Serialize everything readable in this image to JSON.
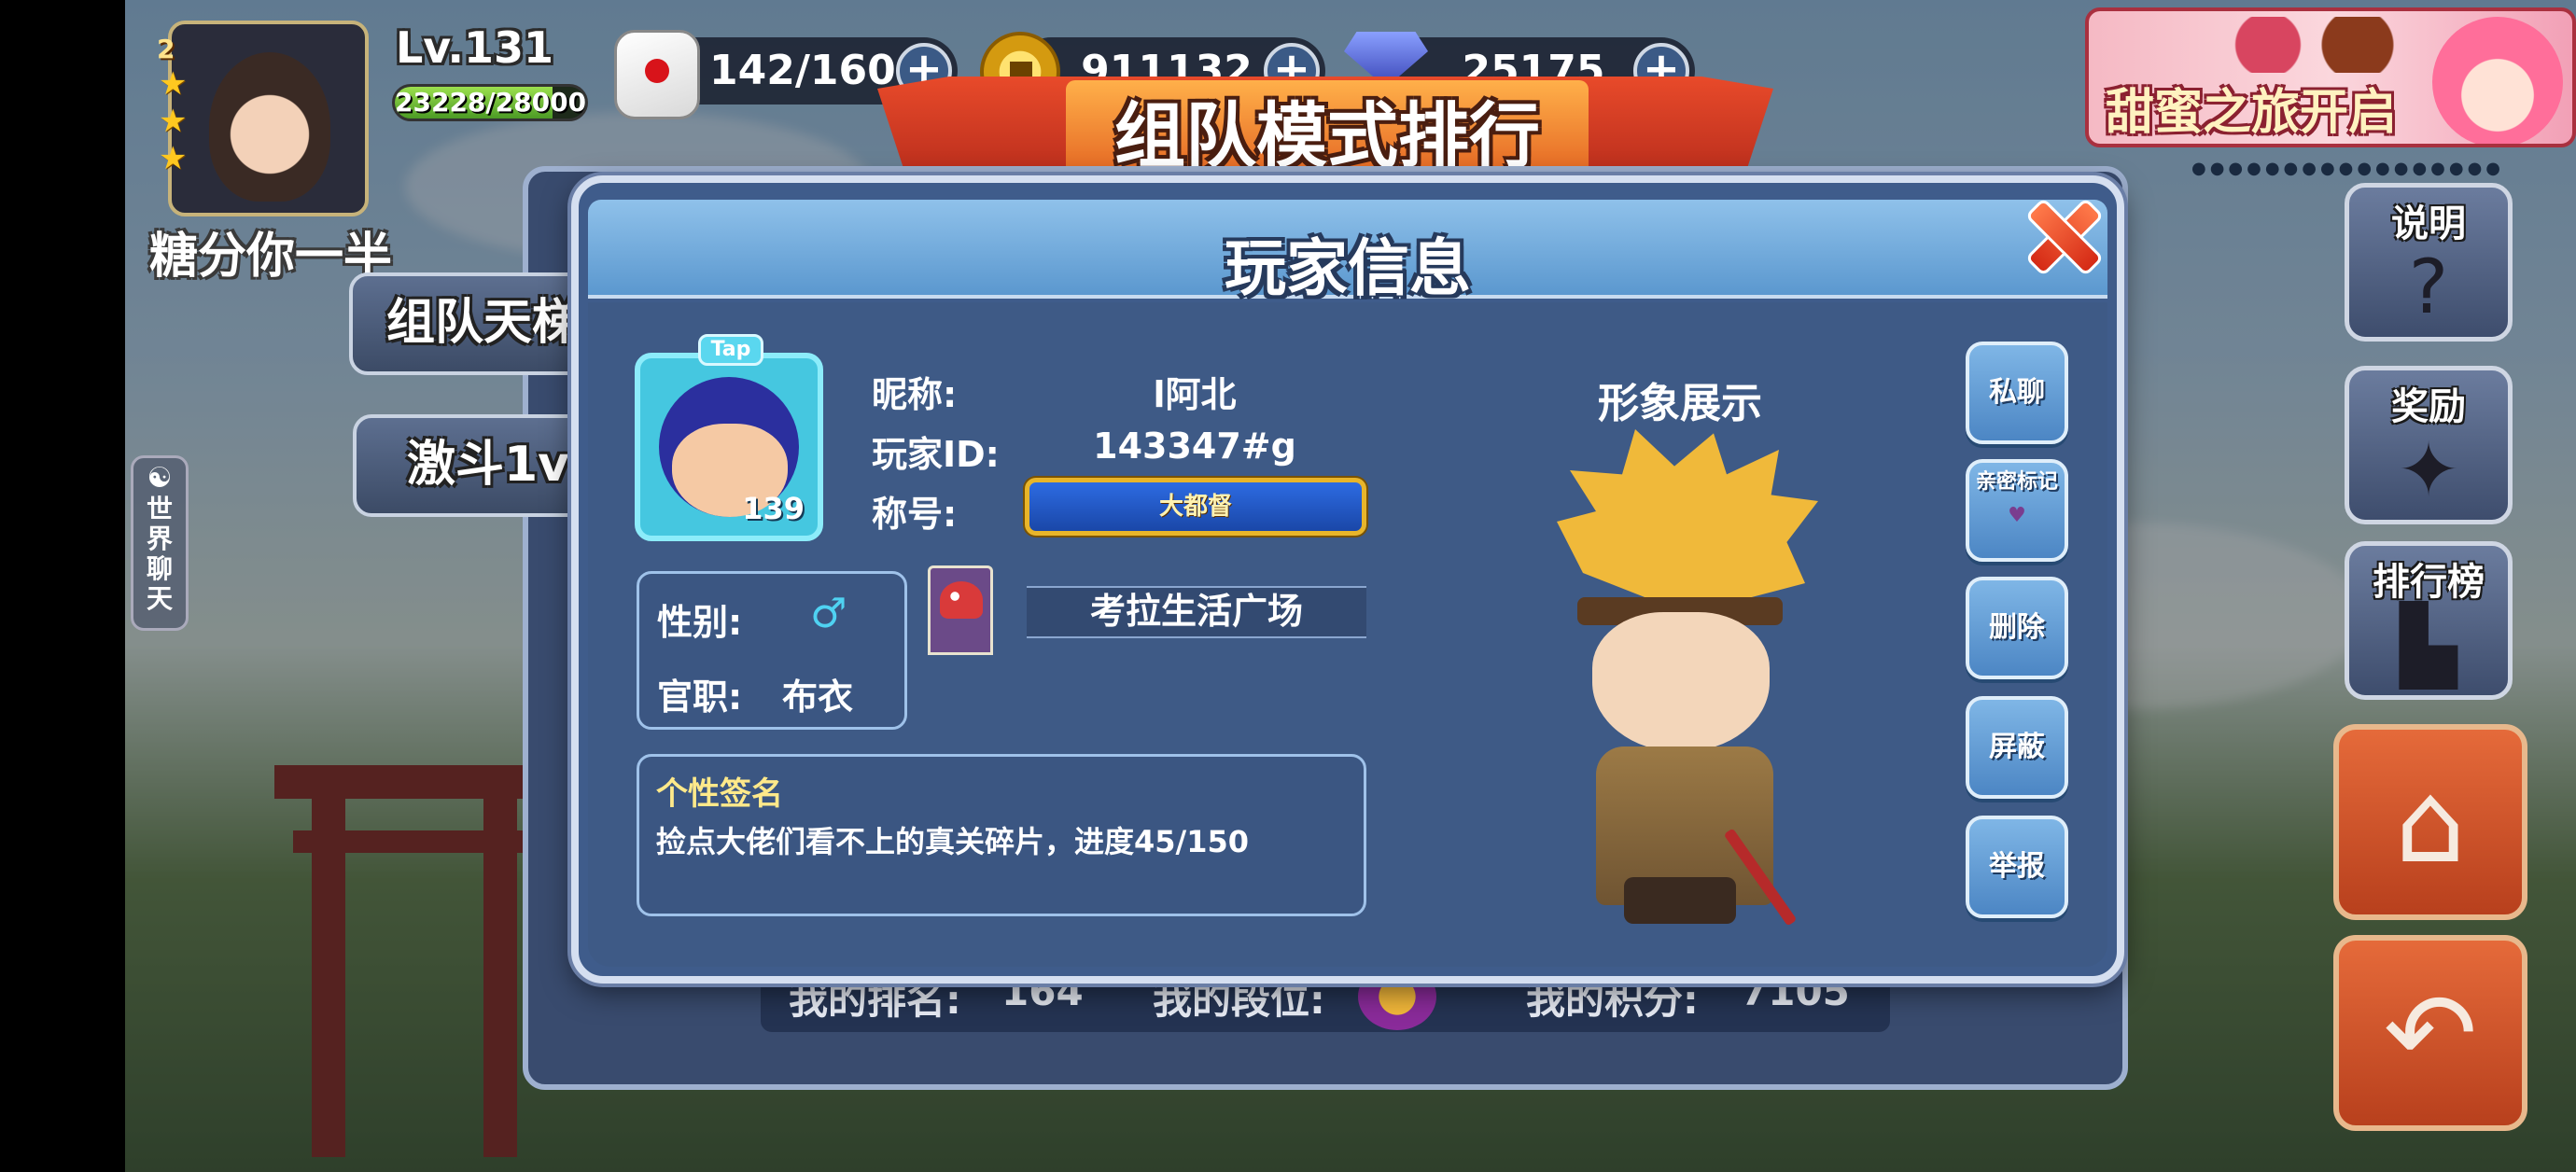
{
  "player_hud": {
    "rank": "2",
    "name": "糖分你一半",
    "level": "Lv.131",
    "exp_text": "23228/28000",
    "exp_fraction": 0.83
  },
  "resources": {
    "stamina": "142/160",
    "gold": "911132",
    "gems": "25175",
    "plus": "+"
  },
  "banner": {
    "title": "组队模式排行"
  },
  "event": {
    "title": "甜蜜之旅开启",
    "dots": "●●●●●●●●●●●●●●●●●"
  },
  "side_tabs": {
    "team_ladder": "组队天梯",
    "duel": "激斗1v1",
    "world_chat_icon": "☯",
    "world_chat": "世\n界\n聊\n天"
  },
  "right_buttons": {
    "help": "说明",
    "help_glyph": "?",
    "reward": "奖励",
    "reward_glyph": "✦",
    "leaderboard": "排行榜",
    "leaderboard_glyph": "▙",
    "home_glyph": "⌂",
    "back_glyph": "↶"
  },
  "my_rank_row": {
    "rank_label": "我的排名:",
    "rank_value": "164",
    "tier_label": "我的段位:",
    "score_label": "我的积分:",
    "score_value": "7105"
  },
  "dialog": {
    "title": "玩家信息",
    "tap_tag": "Tap",
    "avatar_level": "139",
    "nickname_label": "昵称:",
    "nickname": "l阿北",
    "id_label": "玩家ID:",
    "id": "143347#g",
    "title_label": "称号:",
    "title_badge": "大都督",
    "gender_label": "性别:",
    "gender_symbol": "♂",
    "office_label": "官职:",
    "office": "布衣",
    "guild": "考拉生活广场",
    "signature_title": "个性签名",
    "signature": "捡点大佬们看不上的真关碎片，进度45/150",
    "showcase_title": "形象展示",
    "actions": {
      "chat": "私聊",
      "mark": "亲密标记",
      "mark_icon": "♥",
      "delete": "删除",
      "block": "屏蔽",
      "report": "举报"
    }
  },
  "colors": {
    "dialog_bg": "#3f5c8b",
    "header_bg": "#5b98cf",
    "accent_gold": "#e8b52a",
    "signature_title": "#ffe98a"
  }
}
